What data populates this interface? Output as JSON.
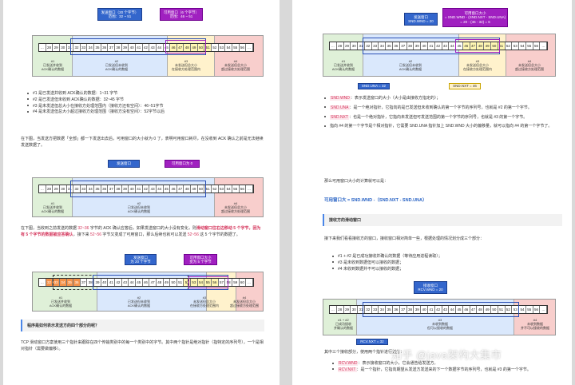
{
  "left": {
    "d1": {
      "send_window": "发送窗口（20 个字节）\n范围：32 ~ 51",
      "usable_window": "可用窗口（6 个字节）\n范围：46 ~ 51",
      "cells": [
        "...",
        "28",
        "29",
        "30",
        "31",
        "32",
        "33",
        "34",
        "35",
        "36",
        "37",
        "38",
        "39",
        "40",
        "41",
        "42",
        "43",
        "44",
        "45",
        "46",
        "47",
        "48",
        "49",
        "50",
        "51",
        "52",
        "53",
        "54",
        "55",
        "56",
        "..."
      ],
      "zone_labels": [
        "#1\n已发送并收到\nACK确认的数据",
        "#2\n已发送但未收到\nACK确认的数据",
        "#3\n未发送但总大小\n在接收方处理范围内",
        "#4\n未发送但总大小\n超过接收方处理范围"
      ]
    },
    "bullets1": [
      "#1 是已发送并收到 ACK确认的数据：1~31 字节",
      "#2 是已发送但未收到 ACK确认的数据：32~45 字节",
      "#3 是未发送但总大小在接收方处理范围内（接收方还有空间）：46~51字节",
      "#4 是未发送但总大小超过接收方处理范围（接收方没有空间）：52字节以后"
    ],
    "para1": "在下图，当发送方把数据「全部」都一下发送出去后，可用窗口的大小就为 0 了，表明可用窗口耗尽，在没收到 ACK 确认之前是无法继续发送数据了。",
    "d2": {
      "send_window": "发送窗口",
      "usable_window": "可用窗口为 0",
      "cells": [
        "...",
        "28",
        "29",
        "30",
        "31",
        "32",
        "33",
        "34",
        "35",
        "36",
        "37",
        "38",
        "39",
        "40",
        "41",
        "42",
        "43",
        "44",
        "45",
        "46",
        "47",
        "48",
        "49",
        "50",
        "51",
        "52",
        "53",
        "54",
        "55",
        "56",
        "..."
      ],
      "zone_labels": [
        "#1\n已发送并收到\nACK确认的数据",
        "#2\n已发送但未收到\nACK确认的数据",
        "#4\n未发送但总大小\n超过接收方处理范围"
      ]
    },
    "para2_a": "在下图，当收到之前发送的数据",
    "para2_b": "32~36",
    "para2_c": "字节的 ACK 确认应答后，如果发送窗口的大小没有变化，则",
    "para2_d": "滑动窗口往右边移动 5 个字节，因为有 5 个字节的数据被应答确认",
    "para2_e": "，接下来",
    "para2_f": "52~56",
    "para2_g": "字节又变成了可用窗口，那么后续也就可以发送",
    "para2_h": "52~56",
    "para2_i": "这 5 个字节的数据了。",
    "d3": {
      "send_window": "发送窗口\n为 20 个字节",
      "usable_window": "可用窗口大小\n变为 5 个字节",
      "cells": [
        "...",
        "32",
        "33",
        "34",
        "35",
        "36",
        "37",
        "38",
        "39",
        "40",
        "41",
        "42",
        "43",
        "44",
        "45",
        "46",
        "47",
        "48",
        "49",
        "50",
        "51",
        "52",
        "53",
        "54",
        "55",
        "56",
        "57",
        "58",
        "59",
        "60",
        "..."
      ],
      "zone_labels": [
        "#1\n已发送并收到\nACK确认的数据",
        "#2\n已发送但未收到\nACK确认的数据",
        "#3\n未发送但总大小\n在接收方处理范围内",
        "#4\n未发送但总大小\n超过接收方处理范围"
      ]
    },
    "header": "程序是如何表示发送方的四个部分的呢？",
    "para3": "TCP 滑动窗口方案使用三个指针来跟踪在四个传输类别中的每一个类别中的字节。其中两个指针是绝对指针（指特定的序列号），一个是相对指针（需要做偏移）。"
  },
  "right": {
    "d4": {
      "send_window": "发送窗口\nSND.WND = 20",
      "usable_window": "可用窗口大小\n= SND.WND - (SND.NXT - SND.UNA)\n= 20 - (46 - 32) = 6",
      "cells": [
        "...",
        "28",
        "29",
        "30",
        "31",
        "32",
        "33",
        "34",
        "35",
        "36",
        "37",
        "38",
        "39",
        "40",
        "41",
        "42",
        "43",
        "44",
        "45",
        "46",
        "47",
        "48",
        "49",
        "50",
        "51",
        "52",
        "53",
        "54",
        "55",
        "56",
        "..."
      ],
      "zone_labels": [
        "#1\n已发送并收到\nACK确认的数据",
        "#2\n已发送但未收到\nACK确认的数据",
        "#3\n未发送但总大小\n在接收方处理范围内",
        "#4\n未发送但总大小\n超过接收方处理范围"
      ],
      "una": "SND.UNA = 32",
      "nxt": "SND.NXT = 46"
    },
    "bullets": [
      {
        "tag": "SND.WND",
        "text": "：表示发送窗口的大小（大小是由接收方指定的）；"
      },
      {
        "tag": "SND.UNA",
        "text": "：是一个绝对指针，它指向的是已发送但未收到确认的第一个字节的序列号，也就是 #2 的第一个字节。"
      },
      {
        "tag": "SND.NXT",
        "text": "：也是一个绝对指针，它指向未发送但可发送范围的第一个字节的序列号，也就是 #3 的第一个字节。"
      },
      {
        "tag": "",
        "text": "指向 #4 的第一个字节是个相对指针，它需要 SND.UNA 指针加上 SND.WND 大小的偏移量，就可以指向 #4 的第一个字节了。"
      }
    ],
    "calc_intro": "那么可用窗口大小的计算就可以是：",
    "formula": "可用窗口大 = SND.WND -（SND.NXT - SND.UNA）",
    "header": "接收方的滑动窗口",
    "recv_intro": "接下来我们看看接收方的窗口，接收窗口相对简单一些，根据处理的情况划分成三个部分：",
    "recv_bullets": [
      "#1 + #2 是已成功接收并确认的数据（等待应用进程读取）；",
      "#3 是未收到数据但可以接收的数据；",
      "#4 未收到数据并不可以接收的数据；"
    ],
    "d5": {
      "recv_window": "接收窗口\nRCV.WND = 20",
      "cells": [
        "...",
        "28",
        "29",
        "30",
        "31",
        "32",
        "33",
        "34",
        "35",
        "36",
        "37",
        "38",
        "39",
        "40",
        "41",
        "42",
        "43",
        "44",
        "45",
        "46",
        "47",
        "48",
        "49",
        "50",
        "51",
        "52",
        "53",
        "54",
        "55",
        "56",
        "..."
      ],
      "zone_labels": [
        "#1 + #2\n已成功接收\n并确认的数据",
        "#3\n未收到数据\n但可以接收的数据",
        "#4\n未收到数据\n并不可以接收的数据"
      ],
      "nxt": "RCV.NXT = 32"
    },
    "ptr_intro": "其中三个接收部分，使用两个指针进行划分：",
    "ptr_bullets": [
      {
        "tag": "RCV.WND",
        "text": "：表示接收窗口的大小，它会通告给发送方。"
      },
      {
        "tag": "RCV.NXT",
        "text": "：是一个指针，它指向期望从发送方发送来的下一个数据字节的序列号，也就是 #3 的第一个字节。"
      }
    ],
    "watermark": "知乎 @java架构大集市"
  },
  "colors": {
    "blue": "#3366cc",
    "purple": "#a020c0",
    "green_zone": "#dff0d8",
    "blue_zone": "#dae8fc",
    "yellow_zone": "#fff2cc",
    "red_zone": "#f8cecc"
  }
}
